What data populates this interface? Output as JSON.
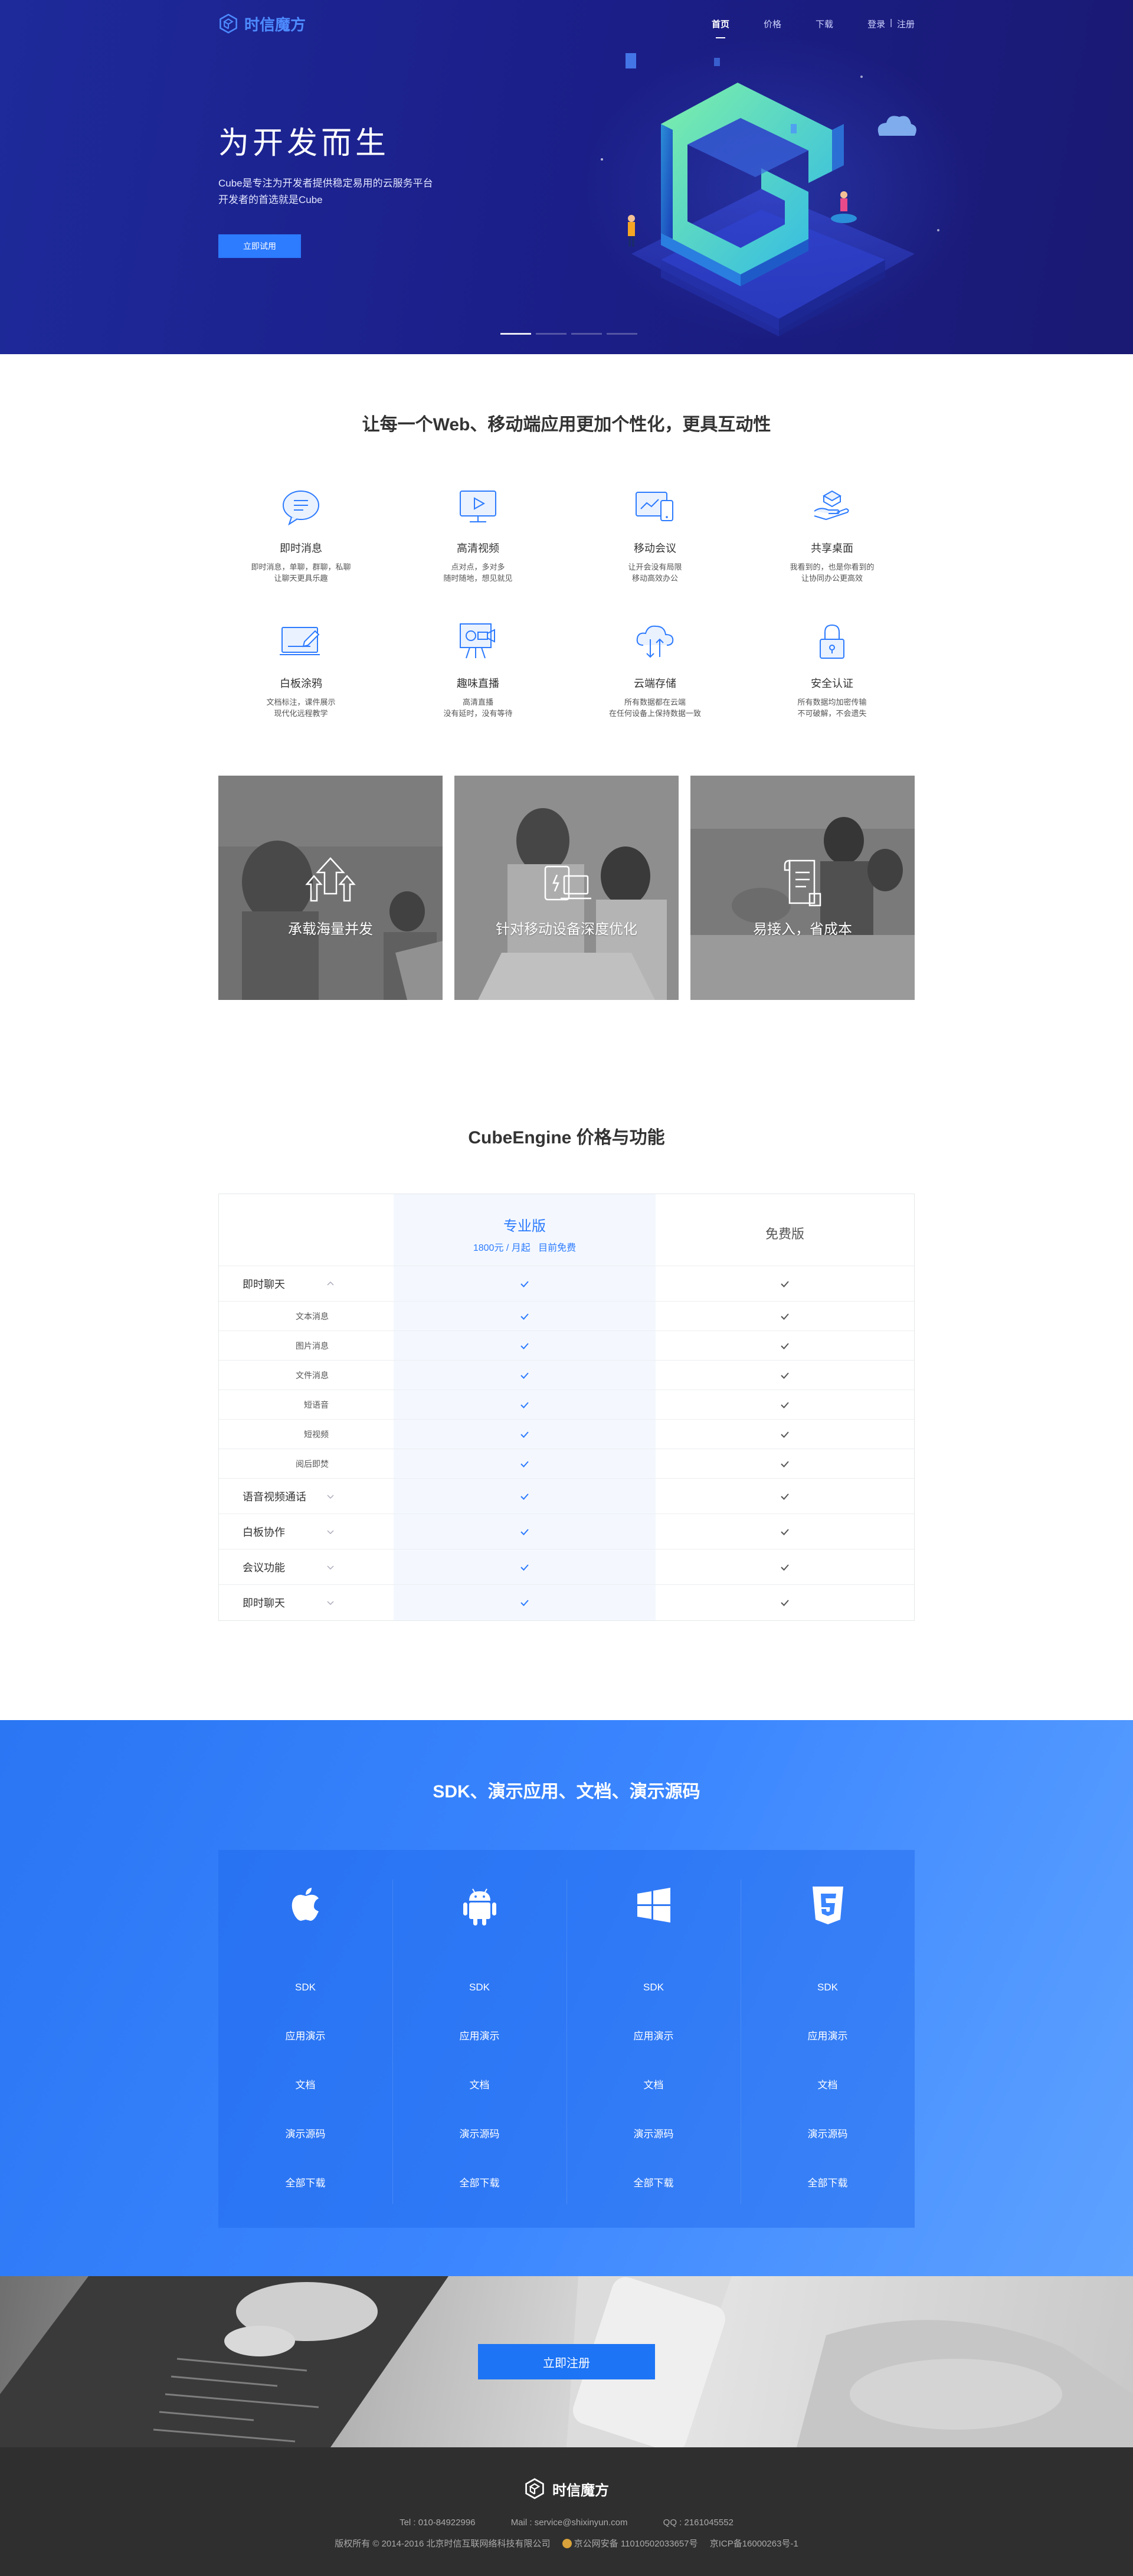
{
  "brand": {
    "name": "时信魔方"
  },
  "nav": {
    "links": [
      {
        "label": "首页",
        "active": true
      },
      {
        "label": "价格",
        "active": false
      },
      {
        "label": "下载",
        "active": false
      }
    ],
    "login": "登录",
    "sep": "|",
    "register": "注册"
  },
  "hero": {
    "title": "为开发而生",
    "line1": "Cube是专注为开发者提供稳定易用的云服务平台",
    "line2": "开发者的首选就是Cube",
    "button": "立即试用",
    "slides": 4,
    "active_slide": 0
  },
  "features": {
    "title": "让每一个Web、移动端应用更加个性化，更具互动性",
    "items": [
      {
        "icon": "chat-bubble-icon",
        "name": "即时消息",
        "desc1": "即时消息，单聊，群聊，私聊",
        "desc2": "让聊天更具乐趣"
      },
      {
        "icon": "video-player-icon",
        "name": "高清视频",
        "desc1": "点对点，多对多",
        "desc2": "随时随地，想见就见"
      },
      {
        "icon": "mobile-meeting-icon",
        "name": "移动会议",
        "desc1": "让开会没有局限",
        "desc2": "移动高效办公"
      },
      {
        "icon": "shared-desktop-icon",
        "name": "共享桌面",
        "desc1": "我看到的，也是你看到的",
        "desc2": "让协同办公更高效"
      },
      {
        "icon": "whiteboard-icon",
        "name": "白板涂鸦",
        "desc1": "文档标注，课件展示",
        "desc2": "现代化远程教学"
      },
      {
        "icon": "live-camera-icon",
        "name": "趣味直播",
        "desc1": "高清直播",
        "desc2": "没有延时，没有等待"
      },
      {
        "icon": "cloud-storage-icon",
        "name": "云端存储",
        "desc1": "所有数据都在云端",
        "desc2": "在任何设备上保持数据一致"
      },
      {
        "icon": "security-lock-icon",
        "name": "安全认证",
        "desc1": "所有数据均加密传输",
        "desc2": "不可破解，不会遗失"
      }
    ]
  },
  "photos": [
    {
      "caption": "承载海量并发",
      "icon": "arrows-up-icon"
    },
    {
      "caption": "针对移动设备深度优化",
      "icon": "devices-icon"
    },
    {
      "caption": "易接入，省成本",
      "icon": "document-icon"
    }
  ],
  "pricing": {
    "title": "CubeEngine 价格与功能",
    "pro": {
      "name": "专业版",
      "price": "1800元 / 月起   目前免费"
    },
    "free": {
      "name": "免费版"
    },
    "rows": [
      {
        "label": "即时聊天",
        "type": "main",
        "expanded": true
      },
      {
        "label": "文本消息",
        "type": "sub"
      },
      {
        "label": "图片消息",
        "type": "sub"
      },
      {
        "label": "文件消息",
        "type": "sub"
      },
      {
        "label": "短语音",
        "type": "sub"
      },
      {
        "label": "短视频",
        "type": "sub"
      },
      {
        "label": "阅后即焚",
        "type": "sub"
      },
      {
        "label": "语音视频通话",
        "type": "main",
        "expanded": false
      },
      {
        "label": "白板协作",
        "type": "main",
        "expanded": false
      },
      {
        "label": "会议功能",
        "type": "main",
        "expanded": false
      },
      {
        "label": "即时聊天",
        "type": "main",
        "expanded": false
      }
    ]
  },
  "sdk": {
    "title": "SDK、演示应用、文档、演示源码",
    "platforms": [
      {
        "icon": "apple-icon",
        "links": [
          "SDK",
          "应用演示",
          "文档",
          "演示源码",
          "全部下载"
        ]
      },
      {
        "icon": "android-icon",
        "links": [
          "SDK",
          "应用演示",
          "文档",
          "演示源码",
          "全部下载"
        ]
      },
      {
        "icon": "windows-icon",
        "links": [
          "SDK",
          "应用演示",
          "文档",
          "演示源码",
          "全部下载"
        ]
      },
      {
        "icon": "html5-icon",
        "links": [
          "SDK",
          "应用演示",
          "文档",
          "演示源码",
          "全部下载"
        ]
      }
    ]
  },
  "cta": {
    "button": "立即注册"
  },
  "footer": {
    "brand": "时信魔方",
    "tel": "Tel : 010-84922996",
    "mail": "Mail : service@shixinyun.com",
    "qq": "QQ : 2161045552",
    "copyright": "版权所有 © 2014-2016 北京时信互联网络科技有限公司",
    "police": "京公网安备 11010502033657号",
    "icp": "京ICP备16000263号-1"
  },
  "colors": {
    "hero": "#1b1f8a",
    "accent": "#2d7bff",
    "sdk": "#3b86ff",
    "footer": "#2f2f2f"
  }
}
